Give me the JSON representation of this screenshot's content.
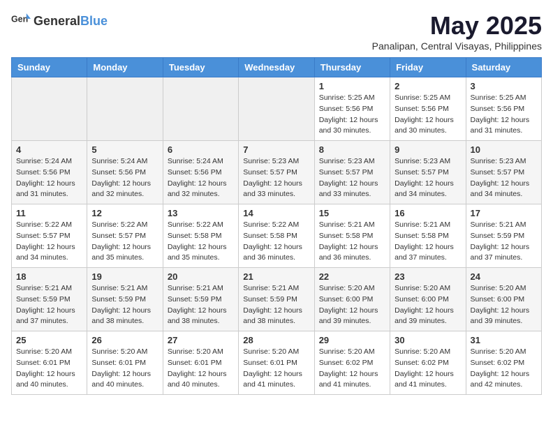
{
  "logo": {
    "general": "General",
    "blue": "Blue"
  },
  "title": "May 2025",
  "subtitle": "Panalipan, Central Visayas, Philippines",
  "days_of_week": [
    "Sunday",
    "Monday",
    "Tuesday",
    "Wednesday",
    "Thursday",
    "Friday",
    "Saturday"
  ],
  "weeks": [
    [
      {
        "day": "",
        "info": ""
      },
      {
        "day": "",
        "info": ""
      },
      {
        "day": "",
        "info": ""
      },
      {
        "day": "",
        "info": ""
      },
      {
        "day": "1",
        "info": "Sunrise: 5:25 AM\nSunset: 5:56 PM\nDaylight: 12 hours\nand 30 minutes."
      },
      {
        "day": "2",
        "info": "Sunrise: 5:25 AM\nSunset: 5:56 PM\nDaylight: 12 hours\nand 30 minutes."
      },
      {
        "day": "3",
        "info": "Sunrise: 5:25 AM\nSunset: 5:56 PM\nDaylight: 12 hours\nand 31 minutes."
      }
    ],
    [
      {
        "day": "4",
        "info": "Sunrise: 5:24 AM\nSunset: 5:56 PM\nDaylight: 12 hours\nand 31 minutes."
      },
      {
        "day": "5",
        "info": "Sunrise: 5:24 AM\nSunset: 5:56 PM\nDaylight: 12 hours\nand 32 minutes."
      },
      {
        "day": "6",
        "info": "Sunrise: 5:24 AM\nSunset: 5:56 PM\nDaylight: 12 hours\nand 32 minutes."
      },
      {
        "day": "7",
        "info": "Sunrise: 5:23 AM\nSunset: 5:57 PM\nDaylight: 12 hours\nand 33 minutes."
      },
      {
        "day": "8",
        "info": "Sunrise: 5:23 AM\nSunset: 5:57 PM\nDaylight: 12 hours\nand 33 minutes."
      },
      {
        "day": "9",
        "info": "Sunrise: 5:23 AM\nSunset: 5:57 PM\nDaylight: 12 hours\nand 34 minutes."
      },
      {
        "day": "10",
        "info": "Sunrise: 5:23 AM\nSunset: 5:57 PM\nDaylight: 12 hours\nand 34 minutes."
      }
    ],
    [
      {
        "day": "11",
        "info": "Sunrise: 5:22 AM\nSunset: 5:57 PM\nDaylight: 12 hours\nand 34 minutes."
      },
      {
        "day": "12",
        "info": "Sunrise: 5:22 AM\nSunset: 5:57 PM\nDaylight: 12 hours\nand 35 minutes."
      },
      {
        "day": "13",
        "info": "Sunrise: 5:22 AM\nSunset: 5:58 PM\nDaylight: 12 hours\nand 35 minutes."
      },
      {
        "day": "14",
        "info": "Sunrise: 5:22 AM\nSunset: 5:58 PM\nDaylight: 12 hours\nand 36 minutes."
      },
      {
        "day": "15",
        "info": "Sunrise: 5:21 AM\nSunset: 5:58 PM\nDaylight: 12 hours\nand 36 minutes."
      },
      {
        "day": "16",
        "info": "Sunrise: 5:21 AM\nSunset: 5:58 PM\nDaylight: 12 hours\nand 37 minutes."
      },
      {
        "day": "17",
        "info": "Sunrise: 5:21 AM\nSunset: 5:59 PM\nDaylight: 12 hours\nand 37 minutes."
      }
    ],
    [
      {
        "day": "18",
        "info": "Sunrise: 5:21 AM\nSunset: 5:59 PM\nDaylight: 12 hours\nand 37 minutes."
      },
      {
        "day": "19",
        "info": "Sunrise: 5:21 AM\nSunset: 5:59 PM\nDaylight: 12 hours\nand 38 minutes."
      },
      {
        "day": "20",
        "info": "Sunrise: 5:21 AM\nSunset: 5:59 PM\nDaylight: 12 hours\nand 38 minutes."
      },
      {
        "day": "21",
        "info": "Sunrise: 5:21 AM\nSunset: 5:59 PM\nDaylight: 12 hours\nand 38 minutes."
      },
      {
        "day": "22",
        "info": "Sunrise: 5:20 AM\nSunset: 6:00 PM\nDaylight: 12 hours\nand 39 minutes."
      },
      {
        "day": "23",
        "info": "Sunrise: 5:20 AM\nSunset: 6:00 PM\nDaylight: 12 hours\nand 39 minutes."
      },
      {
        "day": "24",
        "info": "Sunrise: 5:20 AM\nSunset: 6:00 PM\nDaylight: 12 hours\nand 39 minutes."
      }
    ],
    [
      {
        "day": "25",
        "info": "Sunrise: 5:20 AM\nSunset: 6:01 PM\nDaylight: 12 hours\nand 40 minutes."
      },
      {
        "day": "26",
        "info": "Sunrise: 5:20 AM\nSunset: 6:01 PM\nDaylight: 12 hours\nand 40 minutes."
      },
      {
        "day": "27",
        "info": "Sunrise: 5:20 AM\nSunset: 6:01 PM\nDaylight: 12 hours\nand 40 minutes."
      },
      {
        "day": "28",
        "info": "Sunrise: 5:20 AM\nSunset: 6:01 PM\nDaylight: 12 hours\nand 41 minutes."
      },
      {
        "day": "29",
        "info": "Sunrise: 5:20 AM\nSunset: 6:02 PM\nDaylight: 12 hours\nand 41 minutes."
      },
      {
        "day": "30",
        "info": "Sunrise: 5:20 AM\nSunset: 6:02 PM\nDaylight: 12 hours\nand 41 minutes."
      },
      {
        "day": "31",
        "info": "Sunrise: 5:20 AM\nSunset: 6:02 PM\nDaylight: 12 hours\nand 42 minutes."
      }
    ]
  ]
}
